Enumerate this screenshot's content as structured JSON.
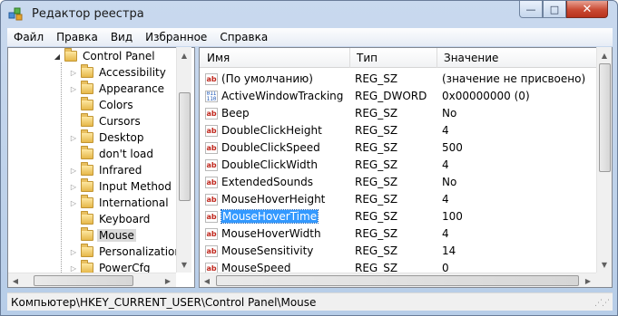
{
  "window": {
    "title": "Редактор реестра",
    "icon": "registry-editor-icon",
    "controls": {
      "minimize": "—",
      "maximize": "□",
      "close": "✕"
    }
  },
  "menu": [
    "Файл",
    "Правка",
    "Вид",
    "Избранное",
    "Справка"
  ],
  "tree": {
    "root": {
      "label": "Control Panel",
      "expanded": true
    },
    "items": [
      {
        "label": "Accessibility",
        "expandable": true
      },
      {
        "label": "Appearance",
        "expandable": true
      },
      {
        "label": "Colors",
        "expandable": false
      },
      {
        "label": "Cursors",
        "expandable": false
      },
      {
        "label": "Desktop",
        "expandable": true
      },
      {
        "label": "don't load",
        "expandable": false
      },
      {
        "label": "Infrared",
        "expandable": true
      },
      {
        "label": "Input Method",
        "expandable": true
      },
      {
        "label": "International",
        "expandable": true
      },
      {
        "label": "Keyboard",
        "expandable": false
      },
      {
        "label": "Mouse",
        "expandable": false,
        "selected": true
      },
      {
        "label": "Personalization",
        "expandable": true
      },
      {
        "label": "PowerCfg",
        "expandable": true
      }
    ]
  },
  "list": {
    "columns": [
      "Имя",
      "Тип",
      "Значение"
    ],
    "rows": [
      {
        "icon": "string-value-icon",
        "name": "(По умолчанию)",
        "type": "REG_SZ",
        "value": "(значение не присвоено)"
      },
      {
        "icon": "binary-value-icon",
        "name": "ActiveWindowTracking",
        "type": "REG_DWORD",
        "value": "0x00000000 (0)"
      },
      {
        "icon": "string-value-icon",
        "name": "Beep",
        "type": "REG_SZ",
        "value": "No"
      },
      {
        "icon": "string-value-icon",
        "name": "DoubleClickHeight",
        "type": "REG_SZ",
        "value": "4"
      },
      {
        "icon": "string-value-icon",
        "name": "DoubleClickSpeed",
        "type": "REG_SZ",
        "value": "500"
      },
      {
        "icon": "string-value-icon",
        "name": "DoubleClickWidth",
        "type": "REG_SZ",
        "value": "4"
      },
      {
        "icon": "string-value-icon",
        "name": "ExtendedSounds",
        "type": "REG_SZ",
        "value": "No"
      },
      {
        "icon": "string-value-icon",
        "name": "MouseHoverHeight",
        "type": "REG_SZ",
        "value": "4"
      },
      {
        "icon": "string-value-icon",
        "name": "MouseHoverTime",
        "type": "REG_SZ",
        "value": "100",
        "selected": true
      },
      {
        "icon": "string-value-icon",
        "name": "MouseHoverWidth",
        "type": "REG_SZ",
        "value": "4"
      },
      {
        "icon": "string-value-icon",
        "name": "MouseSensitivity",
        "type": "REG_SZ",
        "value": "14"
      },
      {
        "icon": "string-value-icon",
        "name": "MouseSpeed",
        "type": "REG_SZ",
        "value": "0"
      }
    ]
  },
  "icon_labels": {
    "string": "ab",
    "binary": "011 110"
  },
  "status": {
    "path": "Компьютер\\HKEY_CURRENT_USER\\Control Panel\\Mouse"
  },
  "colors": {
    "selection": "#3399ff",
    "frame": "#b7cde8",
    "close_button": "#c94a33"
  }
}
